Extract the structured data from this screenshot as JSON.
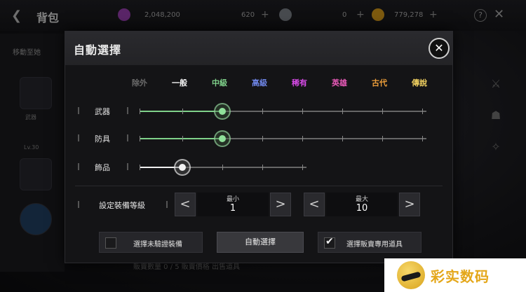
{
  "background": {
    "title": "背包",
    "resources": [
      {
        "icon": "crystal-icon",
        "value": "2,048,200",
        "color": "#c04bd8"
      },
      {
        "icon": "gem-icon",
        "value": "620",
        "color": "#5aa8e8"
      },
      {
        "icon": "diamond-icon",
        "value": "0",
        "color": "#9aa0a8"
      },
      {
        "icon": "gold-coin-icon",
        "value": "779,278",
        "color": "#e0a020"
      }
    ],
    "left_label": "移動至她",
    "left_small_1": "武器",
    "left_small_2": "Lv.30",
    "bottom_text": "販賣數量  0 / 5   販賣價格   出售道具"
  },
  "modal": {
    "title": "自動選擇",
    "close_label": "✕",
    "grades": [
      {
        "label": "除外",
        "color": "#6b6b6b"
      },
      {
        "label": "一般",
        "color": "#f2f2f2"
      },
      {
        "label": "中級",
        "color": "#7fd18a"
      },
      {
        "label": "高級",
        "color": "#6f86e8"
      },
      {
        "label": "稀有",
        "color": "#d84be8"
      },
      {
        "label": "英雄",
        "color": "#e85ab8"
      },
      {
        "label": "古代",
        "color": "#f0a03a"
      },
      {
        "label": "傳說",
        "color": "#f0d060"
      }
    ],
    "rows": [
      {
        "label": "武器",
        "grade_index": 2
      },
      {
        "label": "防具",
        "grade_index": 2
      },
      {
        "label": "飾品",
        "grade_index": 1
      }
    ],
    "level": {
      "label": "設定裝備等級",
      "min_caption": "最小",
      "min_value": "1",
      "max_caption": "最大",
      "max_value": "10",
      "left_arrow": "<",
      "right_arrow": ">"
    },
    "options": {
      "unverified_label": "選擇未驗證裝備",
      "unverified_checked": false,
      "auto_select_label": "自動選擇",
      "sell_only_label": "選擇販賣專用道具",
      "sell_only_checked": true,
      "check_glyph": "✔"
    }
  },
  "watermark": {
    "text": "彩实数码"
  }
}
